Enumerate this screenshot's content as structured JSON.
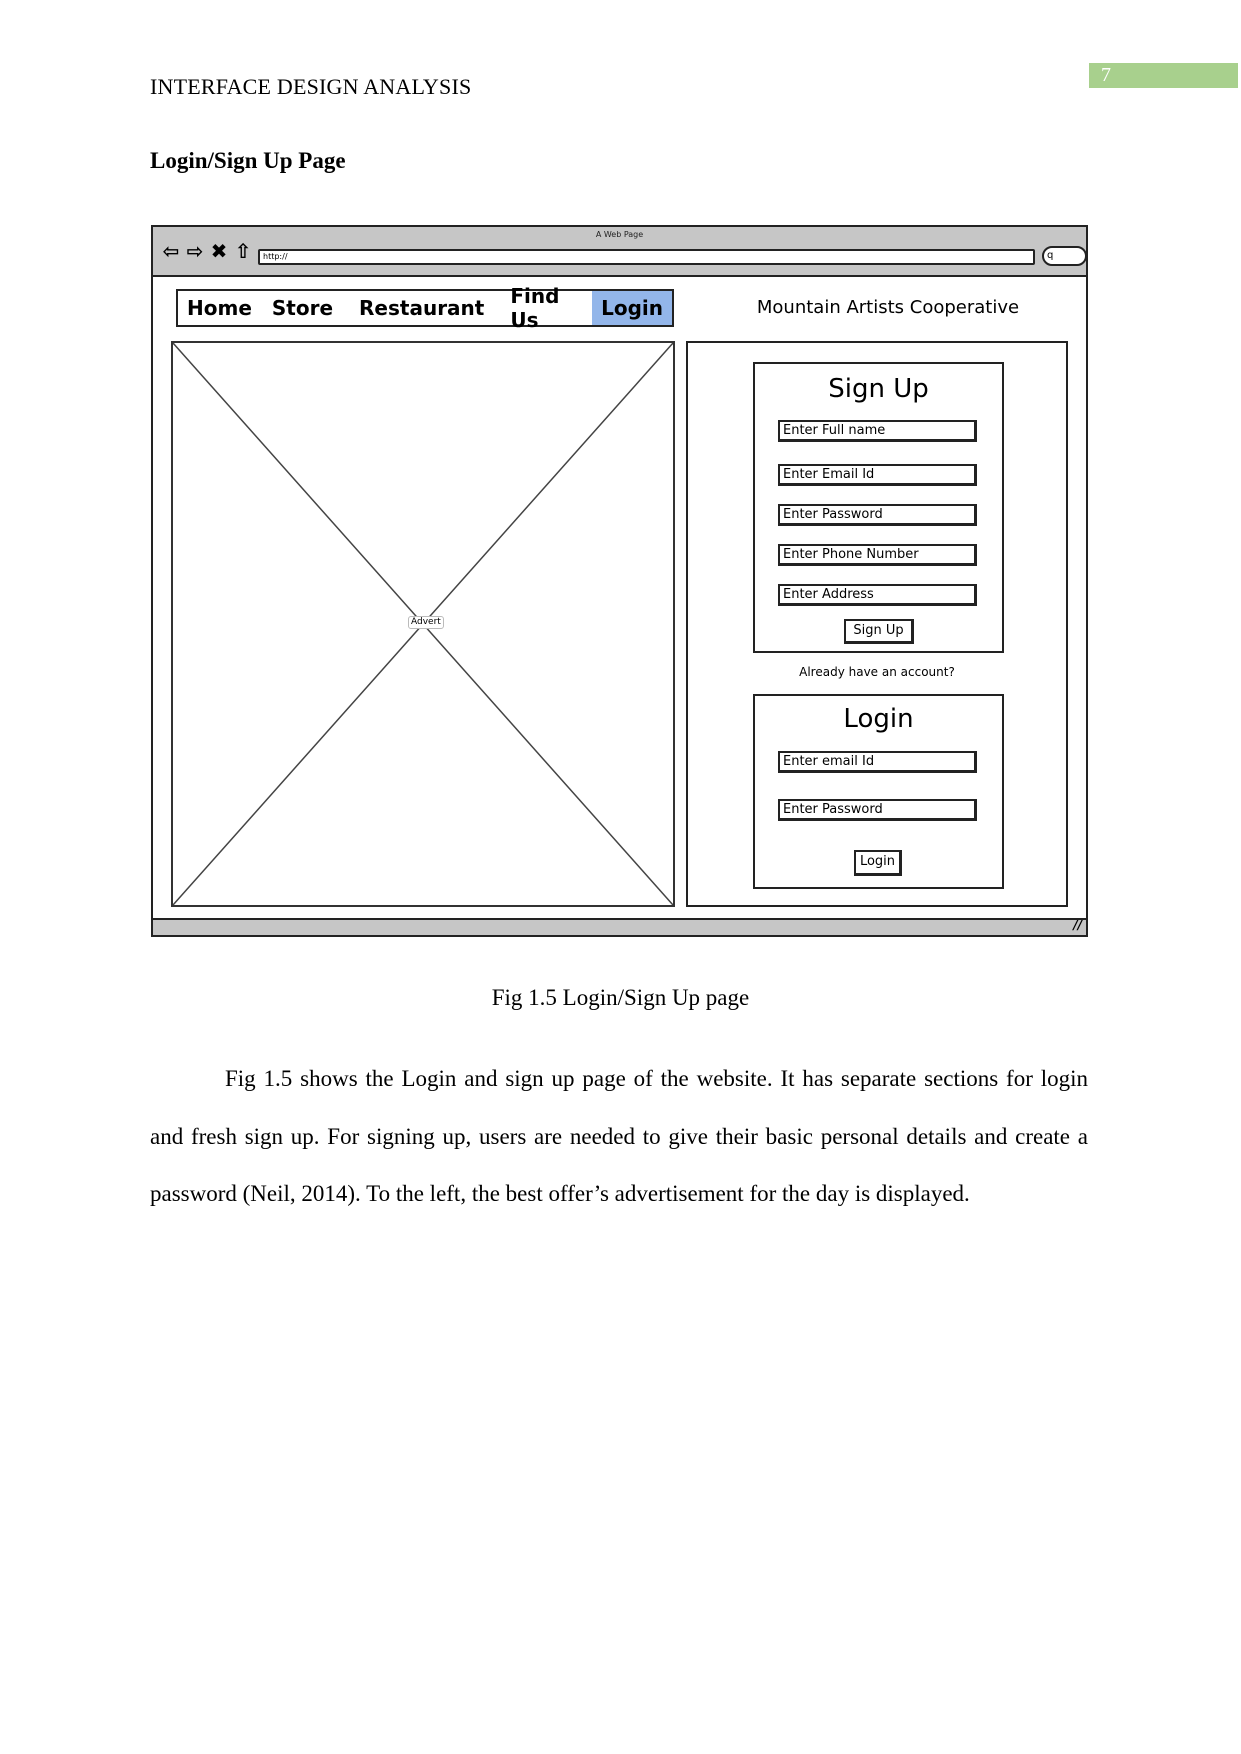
{
  "page": {
    "running_head": "INTERFACE DESIGN ANALYSIS",
    "page_number": "7",
    "page_number_color": "#a8d08d",
    "section_heading": "Login/Sign Up Page"
  },
  "wireframe": {
    "window_title": "A Web Page",
    "url": "http://",
    "search_icon": "q",
    "nav_buttons": [
      "back-icon",
      "forward-icon",
      "stop-icon",
      "home-icon"
    ],
    "nav_glyphs": [
      "⇦",
      "⇨",
      "✖",
      "⇧"
    ],
    "menu": [
      {
        "label": "Home",
        "active": false
      },
      {
        "label": "Store",
        "active": false
      },
      {
        "label": "Restaurant",
        "active": false
      },
      {
        "label": "Find Us",
        "active": false
      },
      {
        "label": "Login",
        "active": true
      }
    ],
    "active_color": "#93b6ea",
    "site_title": "Mountain Artists Cooperative",
    "advert_label": "Advert",
    "signup": {
      "title": "Sign Up",
      "fields": [
        "Enter Full name",
        "Enter Email Id",
        "Enter Password",
        "Enter Phone Number",
        "Enter Address"
      ],
      "button": "Sign Up"
    },
    "already_text": "Already have an account?",
    "login": {
      "title": "Login",
      "fields": [
        "Enter email Id",
        "Enter Password"
      ],
      "button": "Login"
    },
    "resize_glyph": "//"
  },
  "caption": "Fig 1.5 Login/Sign Up page",
  "paragraph": "Fig 1.5 shows the Login and sign up page of the website. It has separate sections for login and fresh sign up. For signing up, users are needed to give their basic personal details and create a password (Neil, 2014). To the left, the best offer’s advertisement for the day is displayed."
}
